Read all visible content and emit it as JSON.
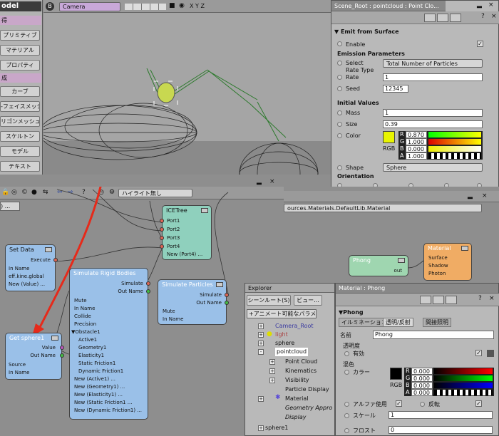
{
  "left_menu": {
    "model_tab": "odel",
    "items": [
      "得",
      "プリミティブ",
      "マテリアル",
      "プロパティ",
      "成",
      "カーブ",
      "-フェイスメッシュ",
      "リゴンメッシュ",
      "スケルトン",
      "モデル",
      "テキスト"
    ]
  },
  "viewport": {
    "letter": "B",
    "camera_label": "Camera",
    "axes": "X Y Z"
  },
  "ppg_pointcloud": {
    "title": "Scene_Root : pointcloud : Point Clo...",
    "emit_header": "Emit from Surface",
    "enable_label": "Enable",
    "emission_section": "Emission Parameters",
    "select_rate_label": "Select Rate Type",
    "select_rate_value": "Total Number of Particles",
    "rate_label": "Rate",
    "rate_value": "1",
    "seed_label": "Seed",
    "seed_value": "12345",
    "initial_section": "Initial Values",
    "mass_label": "Mass",
    "mass_value": "1",
    "size_label": "Size",
    "size_value": "0.39",
    "color_label": "Color",
    "rgb_label": "RGB",
    "color_r": "0.870",
    "color_g": "1.000",
    "color_b": "0.000",
    "color_a": "1.000",
    "shape_label": "Shape",
    "shape_value": "Sphere",
    "orientation_label": "Orientation",
    "swatch_color": "#e8f400"
  },
  "ice_tree": {
    "highlight_dropdown": "ハイライト無し",
    "left_cut_label": ") ...",
    "path_text": "ources.Materials.DefaultLib.Material"
  },
  "nodes": {
    "icetree": {
      "title": "ICETree",
      "ports": [
        "Port1",
        "Port2",
        "Port3",
        "Port4",
        "New (Port4) ..."
      ]
    },
    "setdata": {
      "title": "Set Data",
      "ports": [
        "Execute",
        "In Name",
        "eff.kine.global",
        "New (Value) ..."
      ]
    },
    "rigid": {
      "title": "Simulate Rigid Bodies",
      "simulate": "Simulate",
      "outname": "Out Name",
      "ports": [
        "Mute",
        "In Name",
        "Collide",
        "Precision",
        "▼Obstacle1",
        "Active1",
        "Geometry1",
        "Elasticity1",
        "Static Friction1",
        "Dynamic Friction1",
        "New (Active1) ...",
        "New (Geometry1) ...",
        "New (Elasticity1) ...",
        "New (Static Friction1 ...",
        "New (Dynamic Friction1) ..."
      ]
    },
    "particles": {
      "title": "Simulate Particles",
      "simulate": "Simulate",
      "outname": "Out Name",
      "ports": [
        "Mute",
        "In Name"
      ]
    },
    "getsphere": {
      "title": "Get sphere1",
      "value": "Value",
      "outname": "Out Name",
      "ports": [
        "Source",
        "In Name"
      ]
    },
    "phong": {
      "title": "Phong",
      "out": "out"
    },
    "material": {
      "title": "Material",
      "ports": [
        "Surface",
        "Shadow",
        "Photon"
      ]
    }
  },
  "explorer": {
    "title": "Explorer",
    "scene_root_btn": "シーンルート(S)",
    "view_btn": "ビュー...",
    "filter_text": "+アニメート可能なパラメ",
    "items": [
      "Camera_Root",
      "light",
      "sphere",
      "pointcloud",
      "Point Cloud",
      "Kinematics",
      "Visibility",
      "Particle Display",
      "Material",
      "Geometry Appro",
      "Display",
      "sphere1"
    ]
  },
  "ppg_phong": {
    "title": "Material : Phong",
    "phong_header": "Phong",
    "tabs": [
      "イルミネーション",
      "透明/反射",
      "間接照明"
    ],
    "name_label": "名前",
    "name_value": "Phong",
    "transparency_section": "透明度",
    "enable_label": "有効",
    "mix_section": "混色",
    "color_label": "カラー",
    "rgb_label": "RGB",
    "color_r": "0.000",
    "color_g": "0.000",
    "color_b": "0.000",
    "color_a": "0.000",
    "alpha_label": "アルファ使用",
    "invert_label": "反転",
    "scale_label": "スケール",
    "scale_value": "1",
    "frost_label": "フロスト",
    "frost_value": "0"
  }
}
